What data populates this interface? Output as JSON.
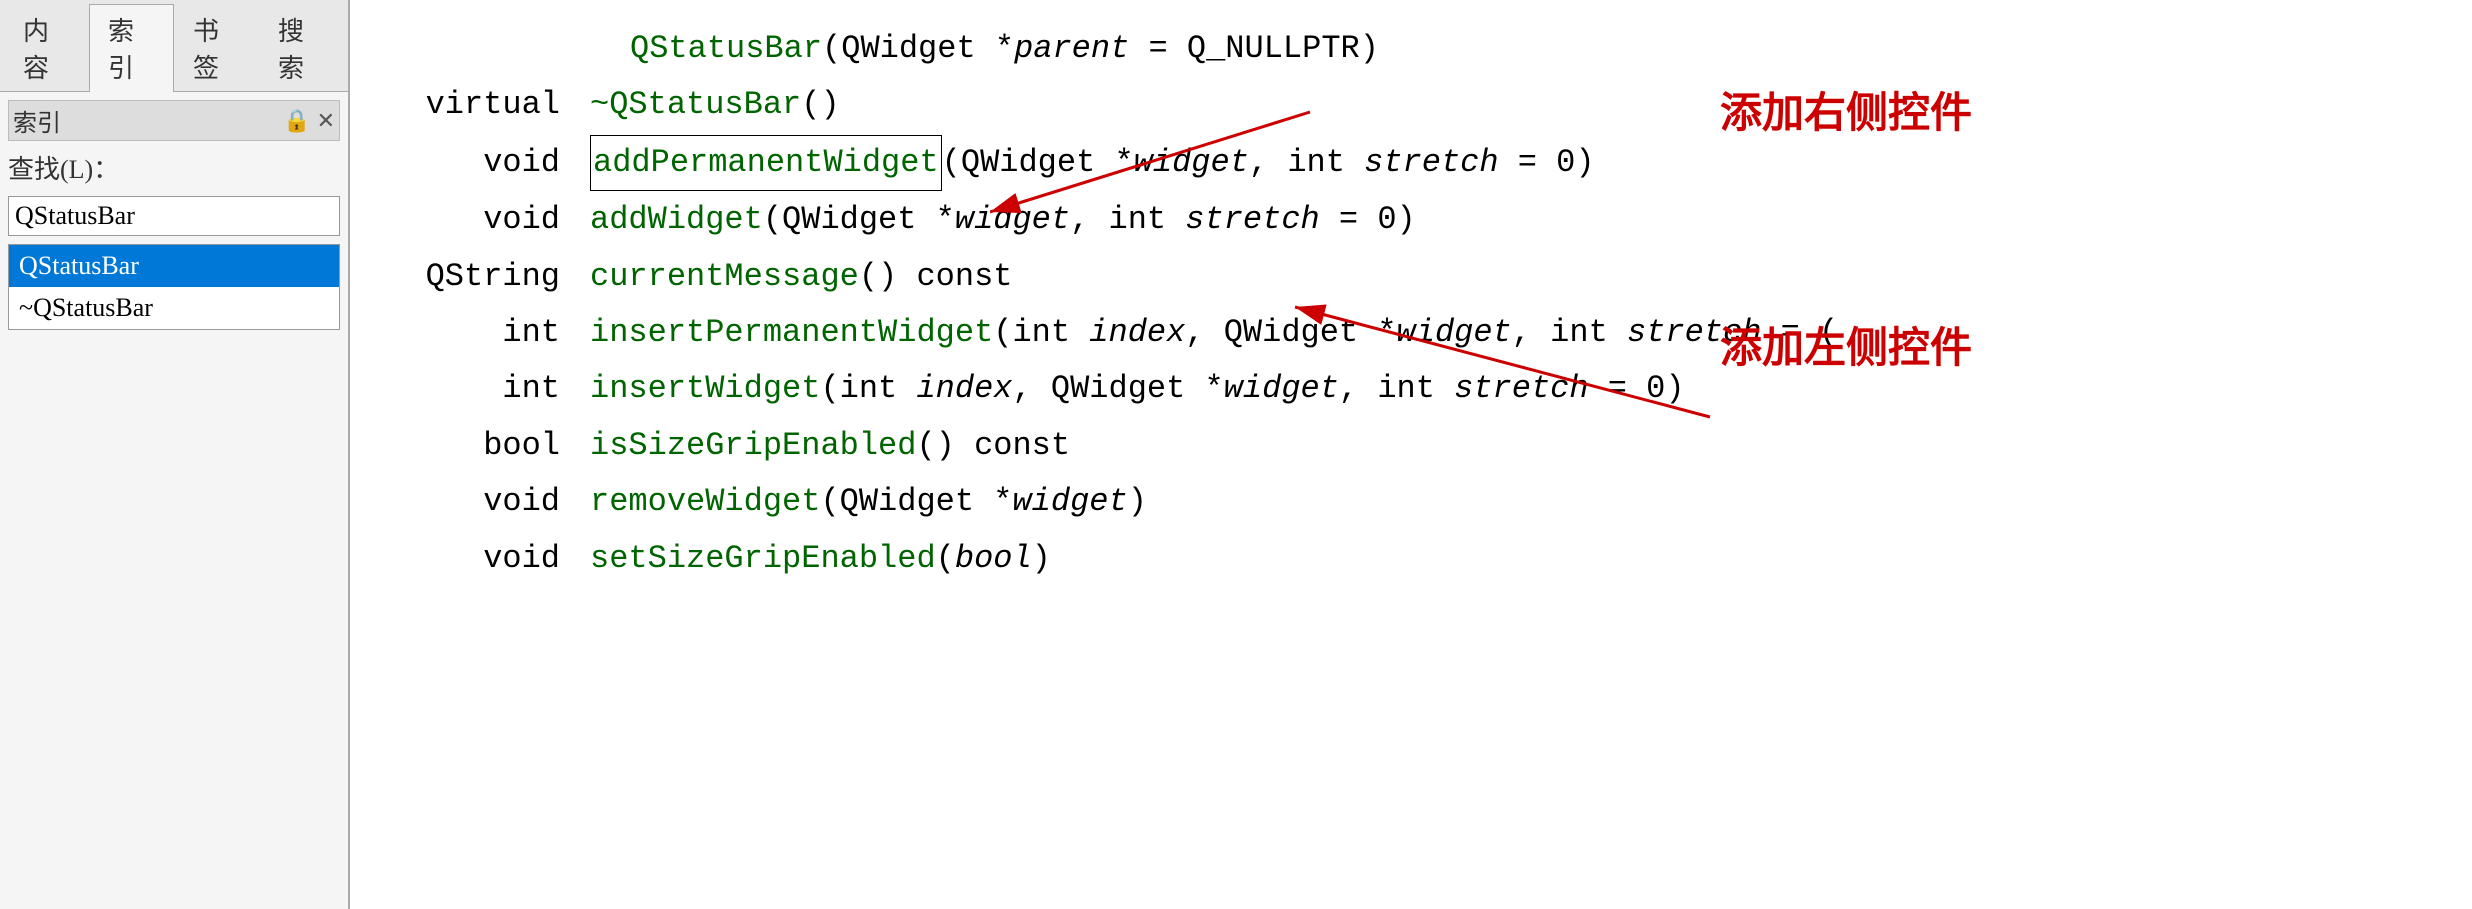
{
  "tabs": [
    {
      "label": "内容",
      "active": false
    },
    {
      "label": "索引",
      "active": true
    },
    {
      "label": "书签",
      "active": false
    },
    {
      "label": "搜索",
      "active": false
    }
  ],
  "panel": {
    "title": "索引",
    "pin_icon": "📌",
    "close_icon": "✕",
    "search_label": "查找(L)：",
    "search_value": "QStatusBar",
    "results": [
      {
        "text": "QStatusBar",
        "selected": true
      },
      {
        "text": "~QStatusBar",
        "selected": false
      }
    ]
  },
  "code": {
    "lines": [
      {
        "ret": "",
        "name": "QStatusBar",
        "params": "(QWidget *parent = Q_NULLPTR)",
        "name_boxed": false,
        "indent": "large"
      },
      {
        "ret": "virtual",
        "name": "~QStatusBar",
        "params": "()",
        "name_boxed": false,
        "indent": "normal"
      },
      {
        "ret": "void",
        "name": "addPermanentWidget",
        "params": "(QWidget *widget,  int stretch = 0)",
        "name_boxed": true,
        "indent": "normal"
      },
      {
        "ret": "void",
        "name": "addWidget",
        "params": "(QWidget *widget,  int stretch = 0)",
        "name_boxed": false,
        "indent": "normal"
      },
      {
        "ret": "QString",
        "name": "currentMessage",
        "params": "() const",
        "name_boxed": false,
        "indent": "normal"
      },
      {
        "ret": "int",
        "name": "insertPermanentWidget",
        "params": "(int index,  QWidget *widget,  int stretch = (",
        "name_boxed": false,
        "indent": "normal"
      },
      {
        "ret": "int",
        "name": "insertWidget",
        "params": "(int index,  QWidget *widget,  int stretch = 0)",
        "name_boxed": false,
        "indent": "normal"
      },
      {
        "ret": "bool",
        "name": "isSizeGripEnabled",
        "params": "() const",
        "name_boxed": false,
        "indent": "normal"
      },
      {
        "ret": "void",
        "name": "removeWidget",
        "params": "(QWidget *widget)",
        "name_boxed": false,
        "indent": "normal"
      },
      {
        "ret": "void",
        "name": "setSizeGripEnabled",
        "params": "(bool)",
        "name_boxed": false,
        "indent": "normal"
      }
    ]
  },
  "annotations": [
    {
      "text": "添加右侧控件",
      "target_line": 2,
      "position": "right"
    },
    {
      "text": "添加左侧控件",
      "target_line": 4,
      "position": "right"
    }
  ]
}
